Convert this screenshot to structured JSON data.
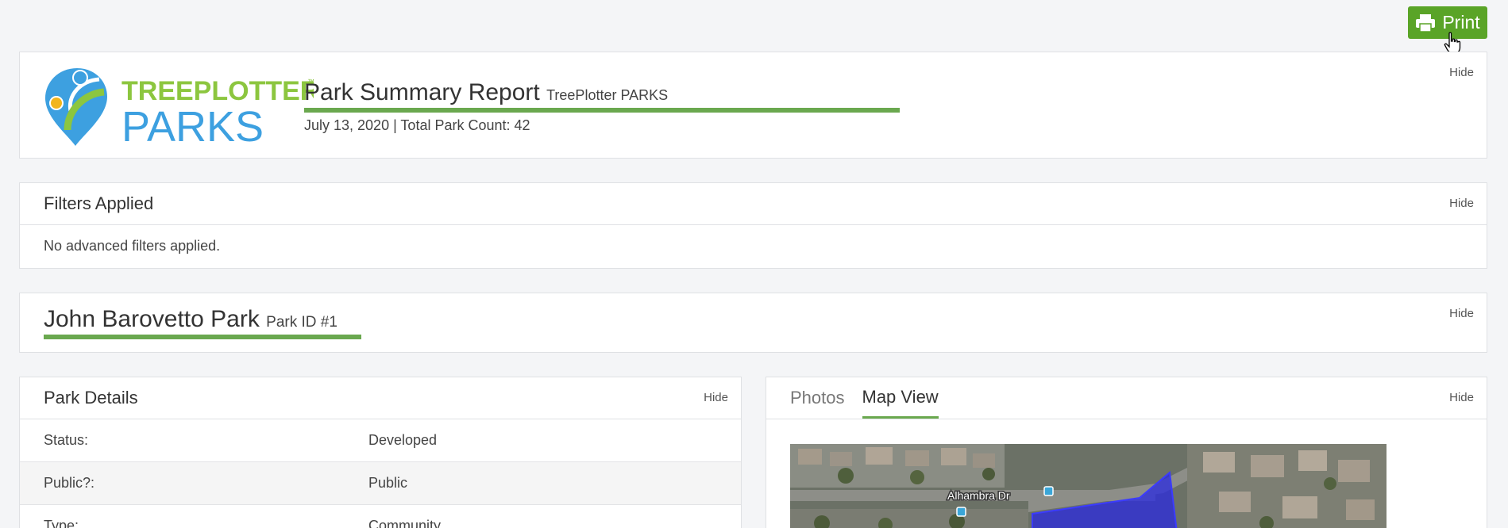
{
  "toolbar": {
    "print_label": "Print"
  },
  "header": {
    "logo_top": "TREEPLOTTER",
    "logo_tm": "™",
    "logo_bottom": "PARKS",
    "title": "Park Summary Report",
    "subtitle": "TreePlotter PARKS",
    "meta": "July 13, 2020 | Total Park Count: 42",
    "hide_label": "Hide"
  },
  "filters": {
    "title": "Filters Applied",
    "body": "No advanced filters applied.",
    "hide_label": "Hide"
  },
  "park": {
    "name": "John Barovetto Park",
    "id_label": "Park ID #1",
    "hide_label": "Hide"
  },
  "details": {
    "title": "Park Details",
    "hide_label": "Hide",
    "rows": [
      {
        "key": "Status:",
        "value": "Developed"
      },
      {
        "key": "Public?:",
        "value": "Public"
      },
      {
        "key": "Type:",
        "value": "Community"
      }
    ]
  },
  "media": {
    "tabs": [
      {
        "label": "Photos"
      },
      {
        "label": "Map View"
      }
    ],
    "hide_label": "Hide",
    "map_street_label": "Alhambra Dr"
  },
  "colors": {
    "brand_green": "#5aa427",
    "accent_line": "#6aa84f",
    "logo_blue": "#3da0e0",
    "park_polygon": "#2a2ae0"
  }
}
